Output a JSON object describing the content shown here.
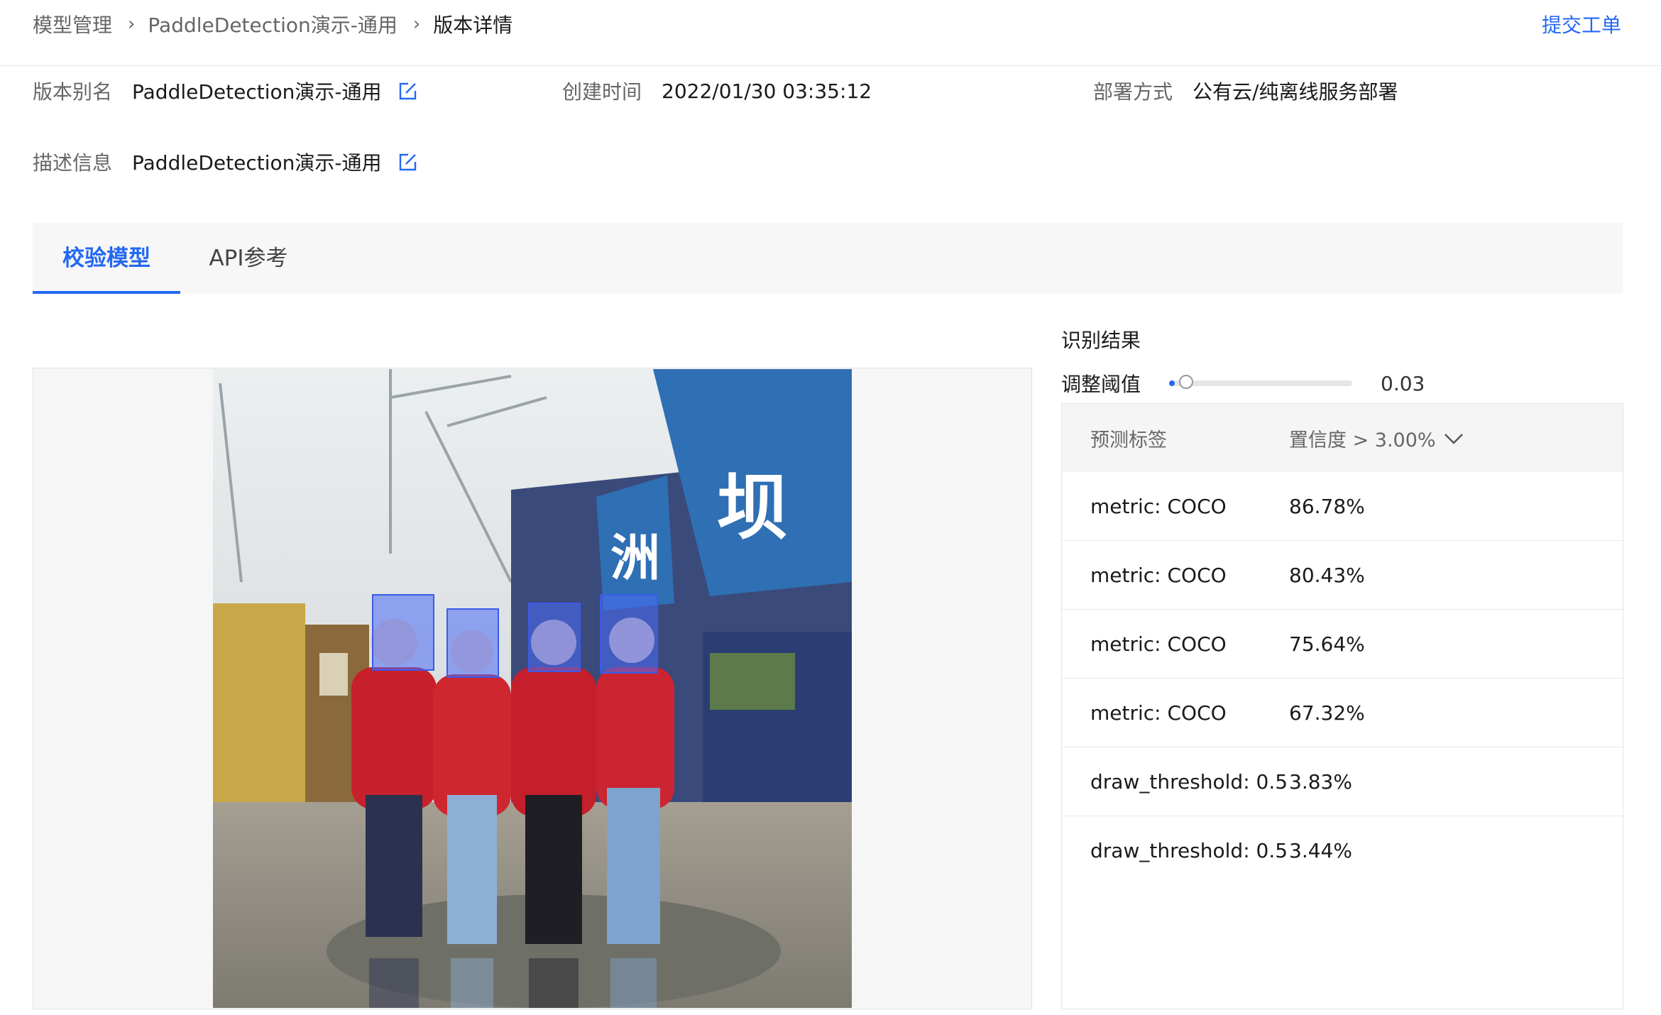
{
  "breadcrumb": {
    "items": [
      "模型管理",
      "PaddleDetection演示-通用",
      "版本详情"
    ]
  },
  "header": {
    "submit_ticket": "提交工单"
  },
  "info": {
    "version_alias": {
      "label": "版本别名",
      "value": "PaddleDetection演示-通用"
    },
    "created_time": {
      "label": "创建时间",
      "value": "2022/01/30 03:35:12"
    },
    "deploy_method": {
      "label": "部署方式",
      "value": "公有云/纯离线服务部署"
    },
    "description": {
      "label": "描述信息",
      "value": "PaddleDetection演示-通用"
    }
  },
  "tabs": [
    {
      "label": "校验模型",
      "active": true
    },
    {
      "label": "API参考",
      "active": false
    }
  ],
  "image_text": [
    "坝",
    "洲"
  ],
  "results": {
    "title": "识别结果",
    "threshold_label": "调整阈值",
    "threshold_value": "0.03",
    "threshold_fraction": 0.03,
    "header": {
      "label": "预测标签",
      "confidence": "置信度 > 3.00%"
    },
    "rows": [
      {
        "label": "metric: COCO",
        "confidence": "86.78%"
      },
      {
        "label": "metric: COCO",
        "confidence": "80.43%"
      },
      {
        "label": "metric: COCO",
        "confidence": "75.64%"
      },
      {
        "label": "metric: COCO",
        "confidence": "67.32%"
      },
      {
        "label": "draw_threshold: 0.5",
        "confidence": "3.83%"
      },
      {
        "label": "draw_threshold: 0.5",
        "confidence": "3.44%"
      }
    ]
  },
  "colors": {
    "accent": "#2468f2",
    "box": "#4a6cf7"
  },
  "icons": {
    "edit": "edit-icon",
    "chevron": "chevron-down-icon",
    "separator": "chevron-right-icon"
  }
}
